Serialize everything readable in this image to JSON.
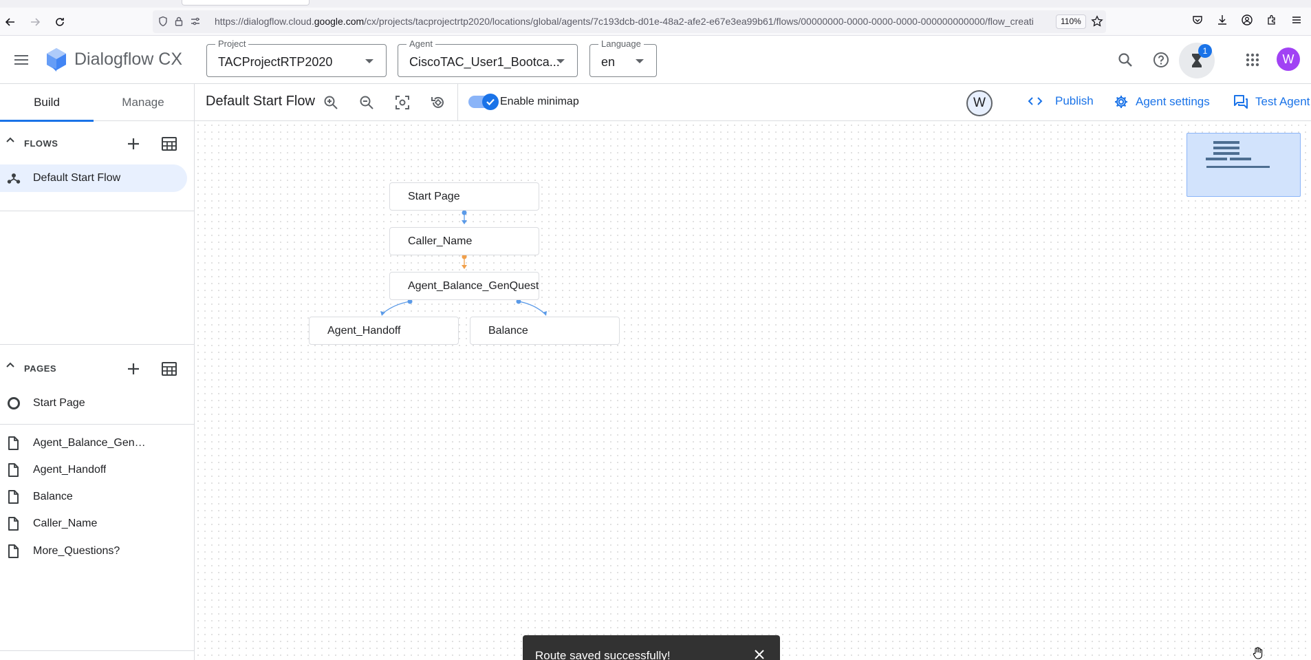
{
  "browser": {
    "url_prefix": "https://dialogflow.cloud.",
    "url_domain": "google.com",
    "url_path": "/cx/projects/tacprojectrtp2020/locations/global/agents/7c193dcb-d01e-48a2-afe2-e67e3ea99b61/flows/00000000-0000-0000-0000-000000000000/flow_creati",
    "zoom": "110%"
  },
  "header": {
    "app_title": "Dialogflow CX",
    "project": {
      "label": "Project",
      "value": "TACProjectRTP2020"
    },
    "agent": {
      "label": "Agent",
      "value": "CiscoTAC_User1_Bootca..."
    },
    "language": {
      "label": "Language",
      "value": "en"
    },
    "notification_count": "1",
    "avatar_initial": "W"
  },
  "left_panel": {
    "tabs": [
      "Build",
      "Manage"
    ],
    "flows_title": "FLOWS",
    "flows": [
      "Default Start Flow"
    ],
    "pages_title": "PAGES",
    "start_page": "Start Page",
    "pages": [
      "Agent_Balance_GenQu...",
      "Agent_Handoff",
      "Balance",
      "Caller_Name",
      "More_Questions?"
    ]
  },
  "toolbar": {
    "flow_title": "Default Start Flow",
    "minimap_label": "Enable minimap",
    "user_initial": "W",
    "publish": "Publish",
    "agent_settings": "Agent settings",
    "test_agent": "Test Agent"
  },
  "canvas": {
    "nodes": [
      "Start Page",
      "Caller_Name",
      "Agent_Balance_GenQuestion",
      "Agent_Handoff",
      "Balance"
    ],
    "toast": "Route saved successfully!"
  }
}
